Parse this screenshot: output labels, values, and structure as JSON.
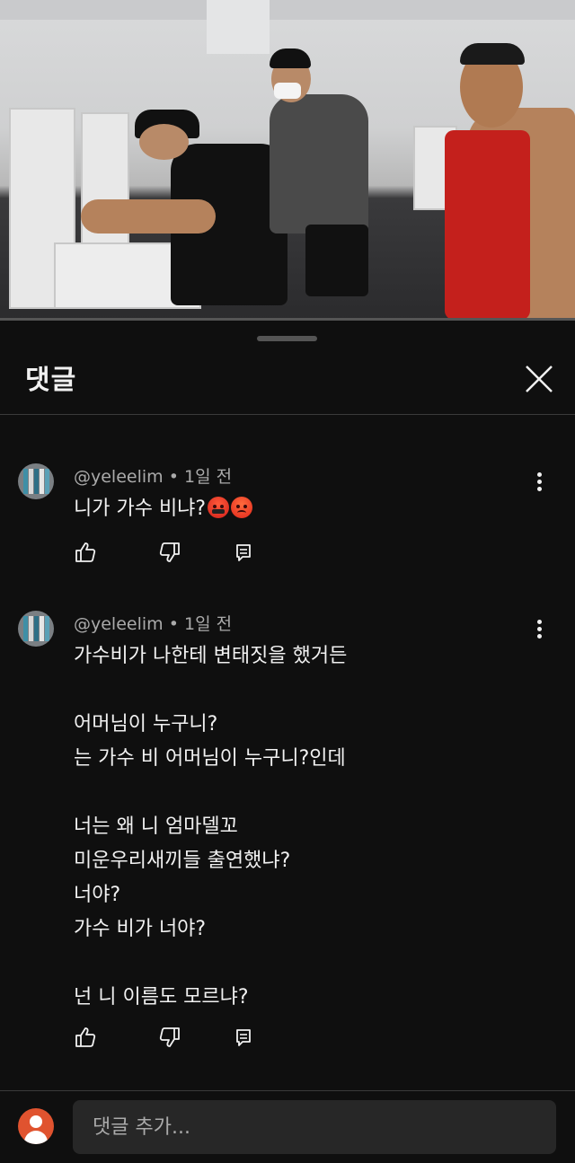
{
  "video": {
    "progress_percent": 0
  },
  "sheet": {
    "title": "댓글"
  },
  "comments": [
    {
      "author": "@yeleelim",
      "separator": "•",
      "time": "1일 전",
      "lines": [
        "니가 가수 비냐?"
      ],
      "emojis": [
        "cursing-face-emoji",
        "angry-face-emoji"
      ]
    },
    {
      "author": "@yeleelim",
      "separator": "•",
      "time": "1일 전",
      "lines": [
        "가수비가 나한테 변태짓을 했거든",
        "",
        "어머님이 누구니?",
        "는 가수 비 어머님이 누구니?인데",
        "",
        "너는 왜 니 엄마델꼬",
        "미운우리새끼들 출연했냐?",
        "너야?",
        "가수 비가 너야?",
        "",
        "넌 니 이름도 모르냐?"
      ]
    }
  ],
  "add_comment": {
    "placeholder": "댓글 추가..."
  },
  "colors": {
    "background": "#0f0f0f",
    "text": "#f1f1f1",
    "meta": "#aaaaaa",
    "input_bg": "#272727",
    "avatar_me": "#e0532f"
  }
}
